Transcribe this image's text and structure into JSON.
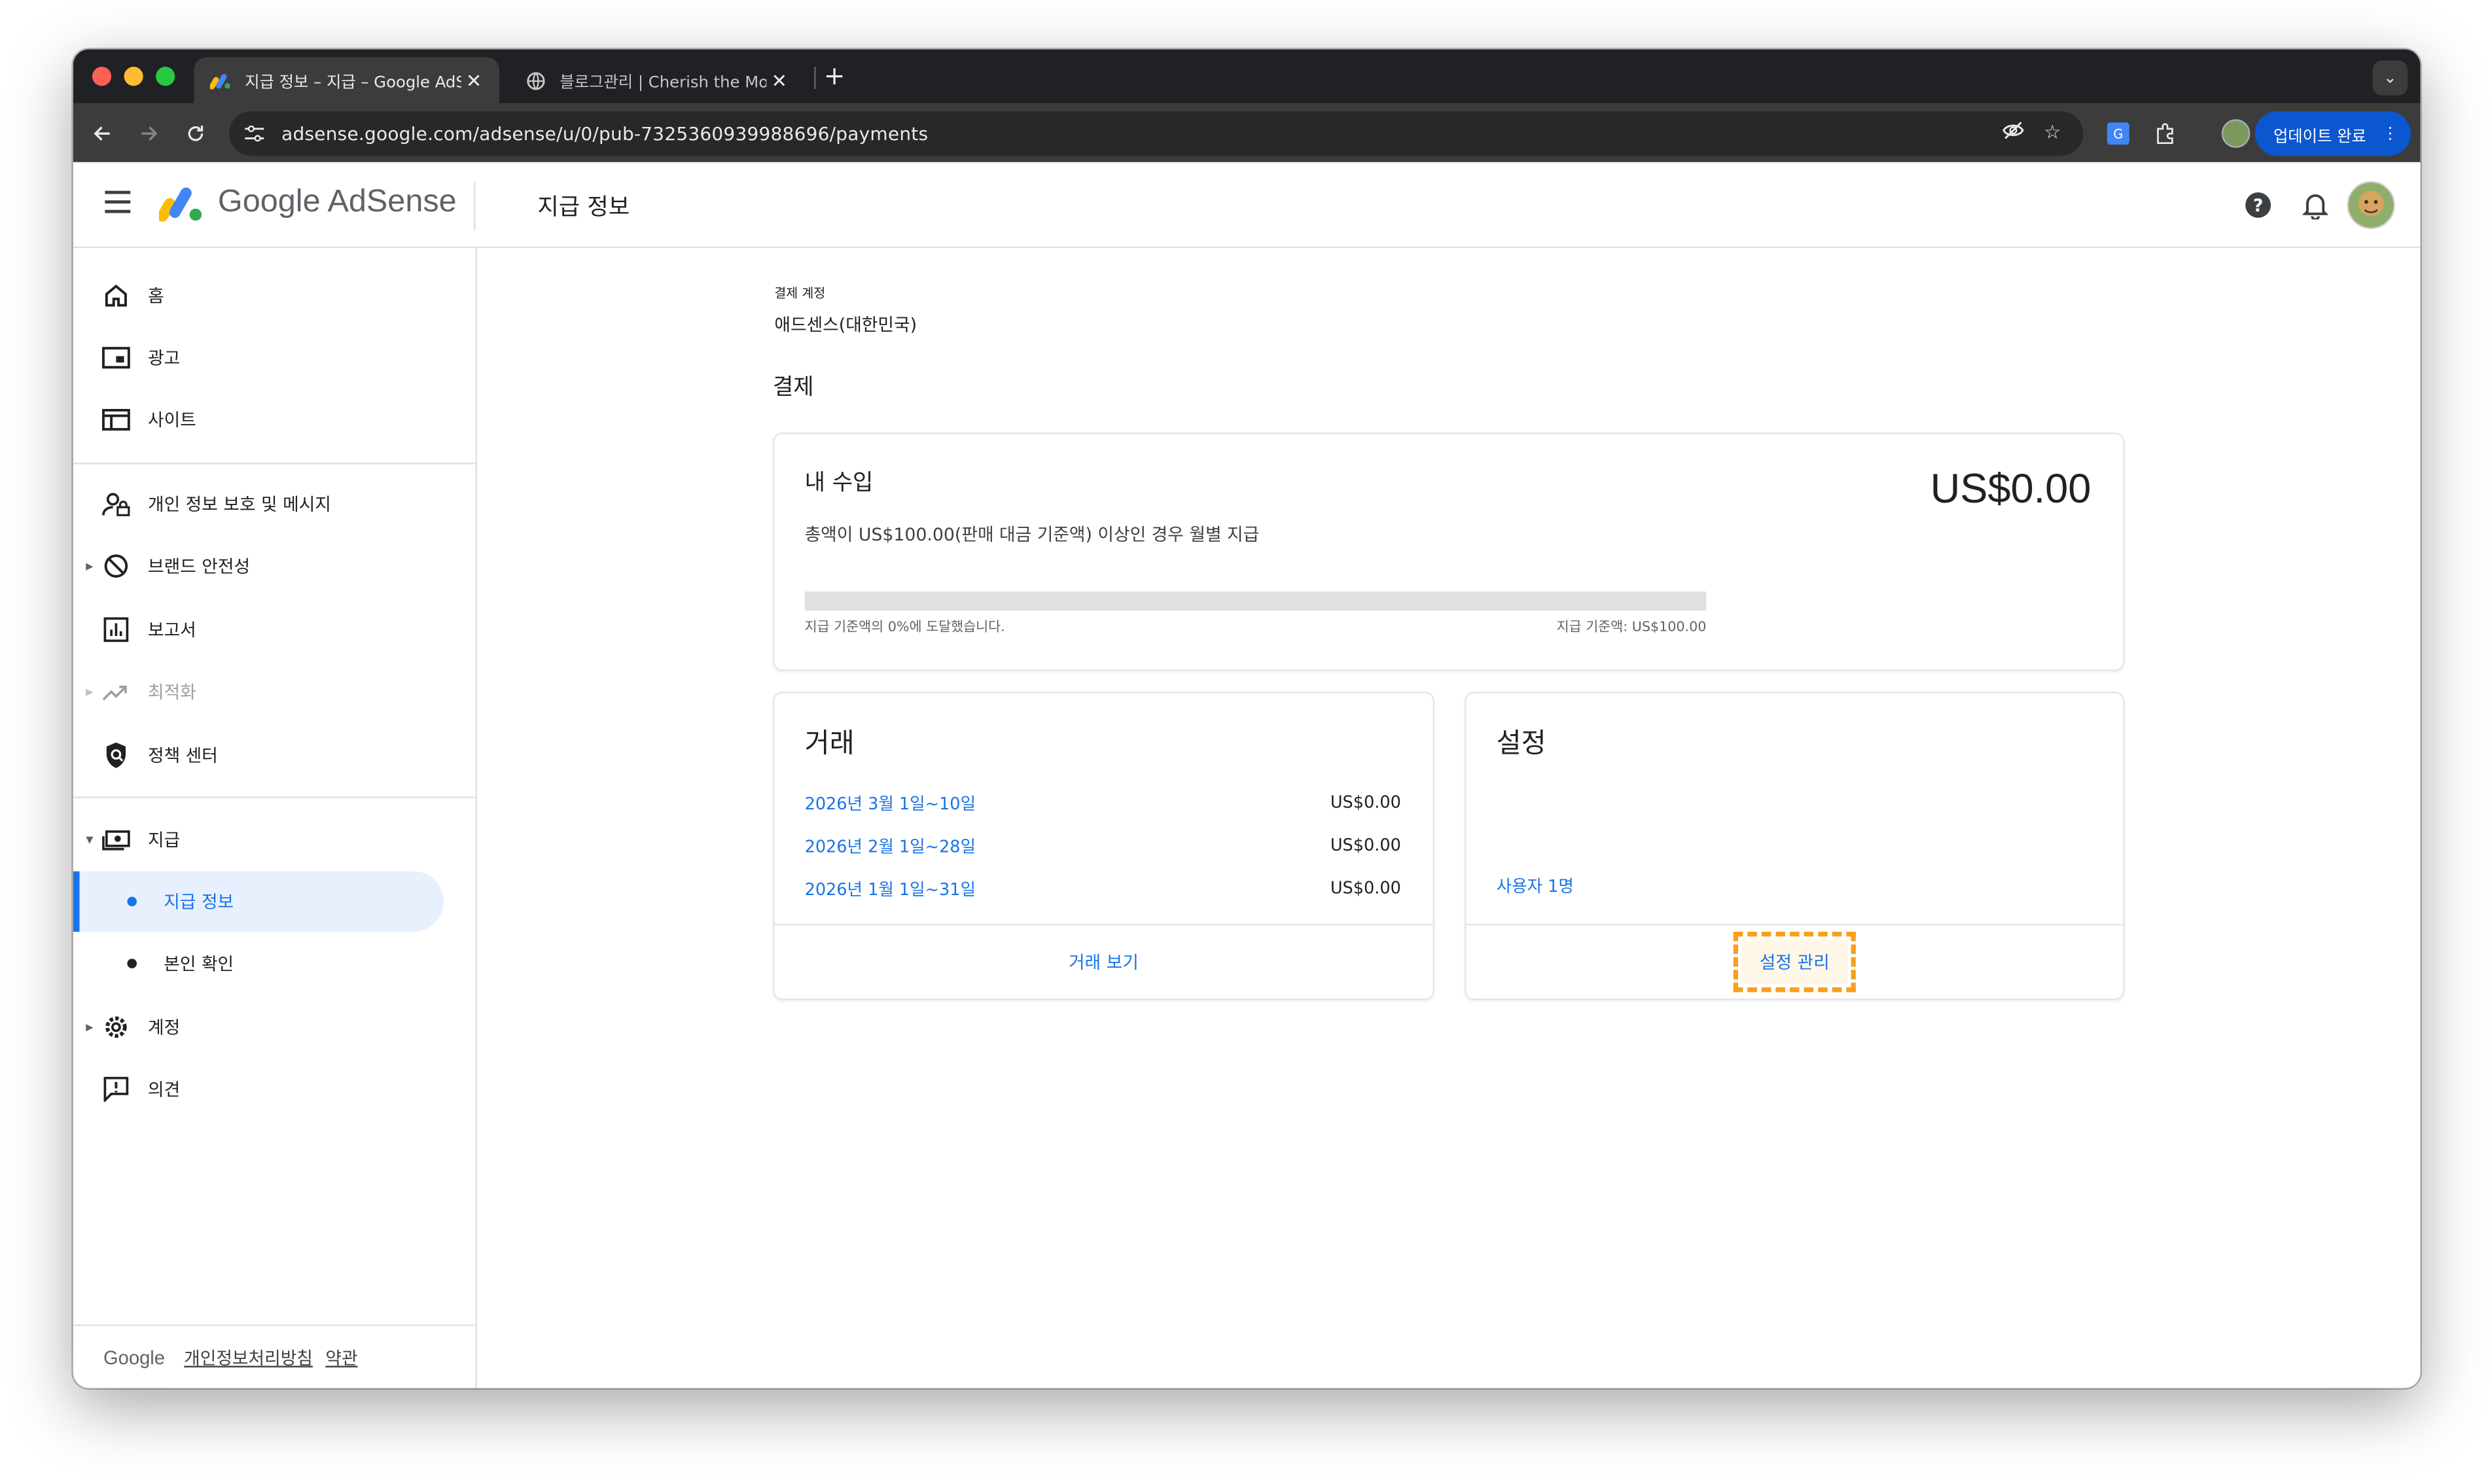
{
  "browser": {
    "tabs": [
      {
        "title": "지급 정보 – 지급 – Google AdSense",
        "active": true
      },
      {
        "title": "블로그관리 | Cherish the Moment",
        "active": false
      }
    ],
    "new_tab": "+",
    "url": "adsense.google.com/adsense/u/0/pub-7325360939988696/payments",
    "update_button": "업데이트 완료",
    "traffic_lights": [
      "#ff5f57",
      "#febc2e",
      "#28c840"
    ]
  },
  "header": {
    "logo_text": "Google AdSense",
    "page_title": "지급 정보"
  },
  "sidebar": {
    "items": [
      {
        "label": "홈",
        "icon": "home-icon"
      },
      {
        "label": "광고",
        "icon": "ads-icon"
      },
      {
        "label": "사이트",
        "icon": "sites-icon"
      },
      {
        "label": "개인 정보 보호 및 메시지",
        "icon": "privacy-icon"
      },
      {
        "label": "브랜드 안전성",
        "icon": "block-icon"
      },
      {
        "label": "보고서",
        "icon": "reports-icon"
      },
      {
        "label": "최적화",
        "icon": "trending-icon"
      },
      {
        "label": "정책 센터",
        "icon": "policy-icon"
      },
      {
        "label": "지급",
        "icon": "payments-icon"
      },
      {
        "label": "계정",
        "icon": "settings-icon"
      },
      {
        "label": "의견",
        "icon": "feedback-icon"
      }
    ],
    "sub_items": [
      {
        "label": "지급 정보",
        "active": true
      },
      {
        "label": "본인 확인",
        "active": false
      }
    ],
    "footer": {
      "brand": "Google",
      "privacy": "개인정보처리방침",
      "terms": "약관"
    }
  },
  "main": {
    "account_label": "결제 계정",
    "account_name": "애드센스(대한민국)",
    "section_title": "결제",
    "earnings": {
      "title": "내 수입",
      "description": "총액이 US$100.00(판매 대금 기준액) 이상인 경우 월별 지급",
      "amount": "US$0.00",
      "progress_percent": 0,
      "progress_left": "지급 기준액의 0%에 도달했습니다.",
      "progress_right": "지급 기준액: US$100.00"
    },
    "transactions": {
      "title": "거래",
      "rows": [
        {
          "period": "2026년 3월 1일~10일",
          "amount": "US$0.00"
        },
        {
          "period": "2026년 2월 1일~28일",
          "amount": "US$0.00"
        },
        {
          "period": "2026년 1월 1일~31일",
          "amount": "US$0.00"
        }
      ],
      "view_button": "거래 보기"
    },
    "settings": {
      "title": "설정",
      "users_link": "사용자 1명",
      "manage_button": "설정 관리"
    }
  },
  "colors": {
    "accent": "#1a73e8",
    "highlight": "#f9a01b",
    "active_nav_bg": "#e8f0fe"
  }
}
